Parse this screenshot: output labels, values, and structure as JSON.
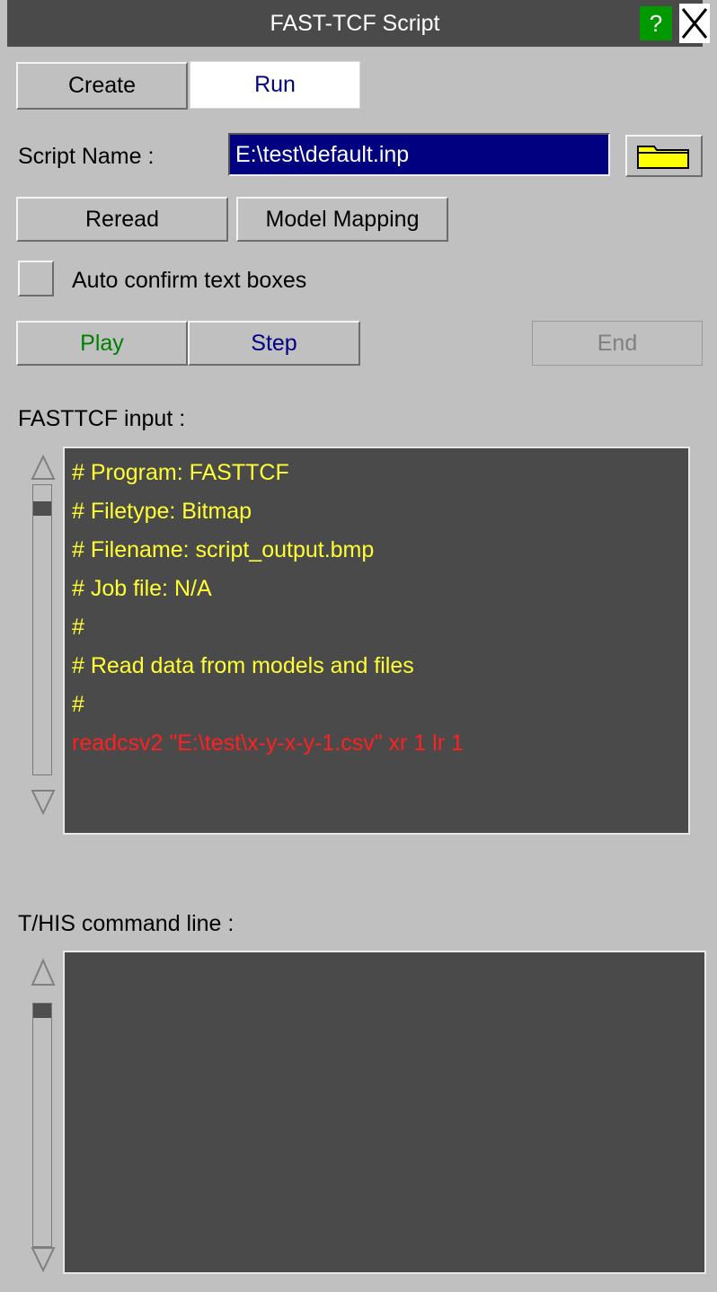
{
  "window": {
    "title": "FAST-TCF Script",
    "help_label": "?"
  },
  "tabs": {
    "create": "Create",
    "run": "Run"
  },
  "script": {
    "label": "Script Name :",
    "value": "E:\\test\\default.inp"
  },
  "buttons": {
    "reread": "Reread",
    "model_mapping": "Model Mapping",
    "play": "Play",
    "step": "Step",
    "end": "End"
  },
  "options": {
    "auto_confirm_label": "Auto confirm text boxes"
  },
  "fasttcf": {
    "label": "FASTTCF input :",
    "lines": [
      "# Program: FASTTCF",
      "# Filetype: Bitmap",
      "# Filename: script_output.bmp",
      "# Job file: N/A",
      "#",
      "# Read data from models and files",
      "#",
      "readcsv2 \"E:\\test\\x-y-x-y-1.csv\" xr 1 lr 1"
    ]
  },
  "thiscmd": {
    "label": "T/HIS command line :"
  },
  "colors": {
    "accent_text": "#000080",
    "play_text": "#008000",
    "comment_text": "#ffff33",
    "command_text": "#ff2020",
    "disabled_text": "#808080",
    "panel_bg": "#4a4a4a"
  }
}
